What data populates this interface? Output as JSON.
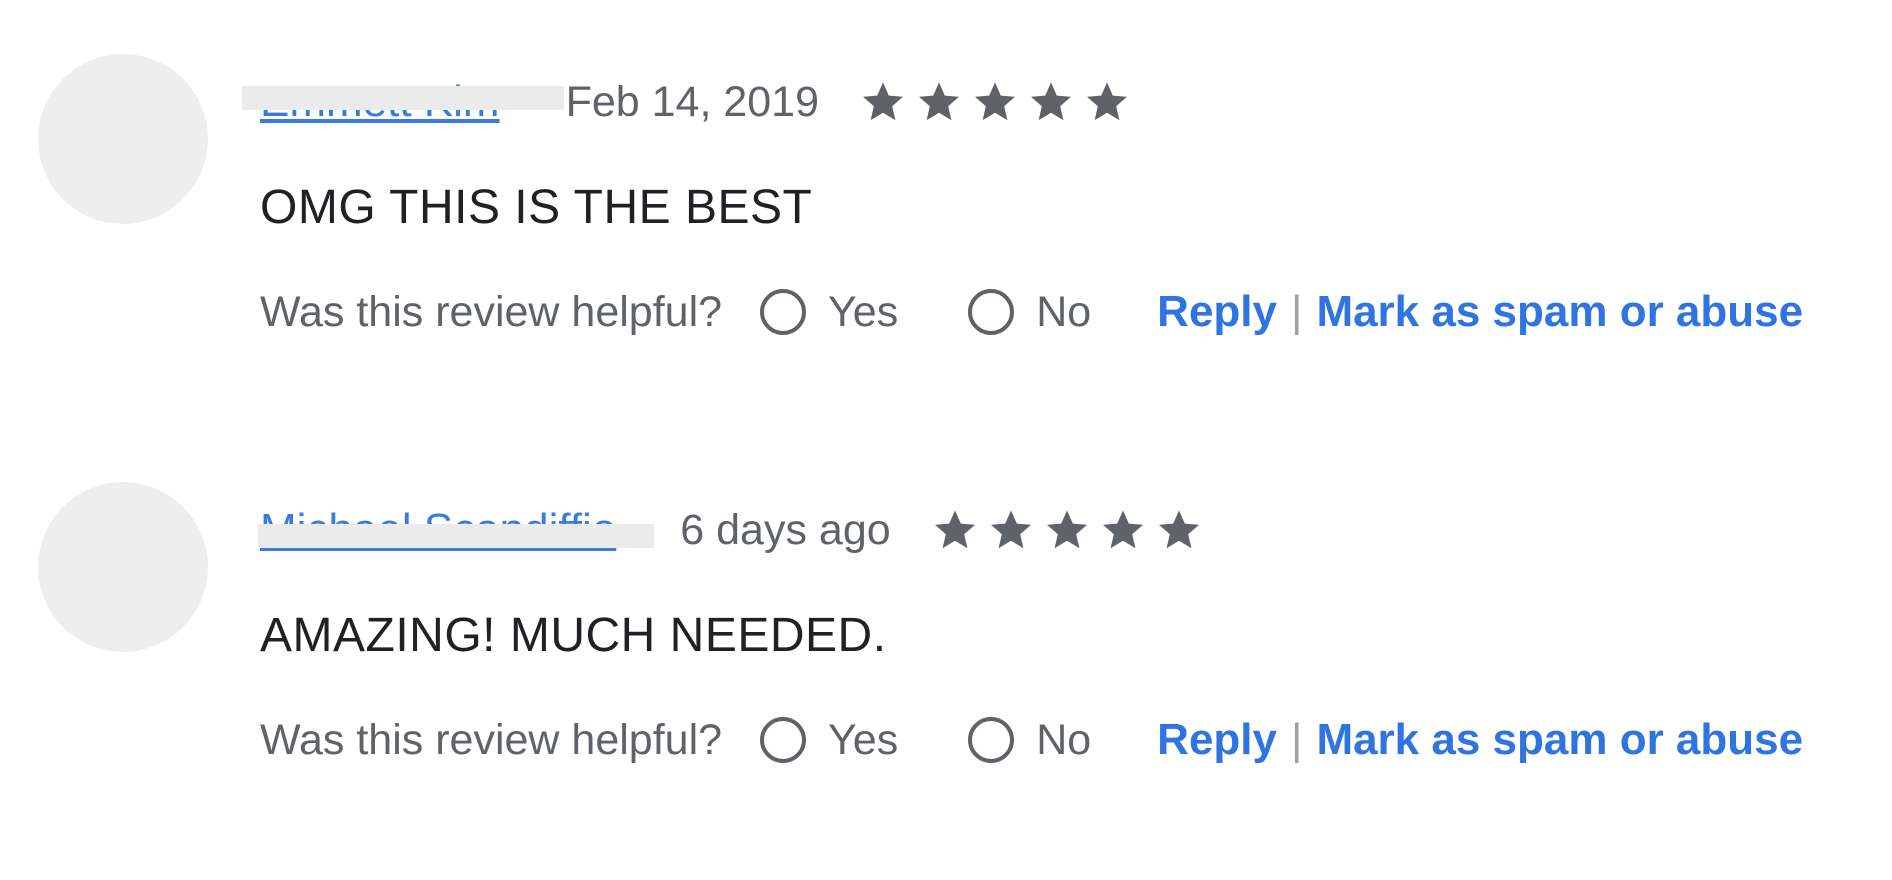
{
  "reviews": [
    {
      "author": "Emmett Kim",
      "date": "Feb 14, 2019",
      "rating": 5,
      "title": "OMG THIS IS THE BEST",
      "helpful_question": "Was this review helpful?",
      "yes_label": "Yes",
      "no_label": "No",
      "reply_label": "Reply",
      "separator": "|",
      "spam_label": "Mark as spam or abuse"
    },
    {
      "author": "Michael Scandiffio",
      "date": "6 days ago",
      "rating": 5,
      "title": "AMAZING! MUCH NEEDED.",
      "helpful_question": "Was this review helpful?",
      "yes_label": "Yes",
      "no_label": "No",
      "reply_label": "Reply",
      "separator": "|",
      "spam_label": "Mark as spam or abuse"
    }
  ],
  "icons": {
    "star": "star-icon",
    "radio": "radio-unchecked-icon"
  },
  "colors": {
    "link": "#2f74e0",
    "star": "#5f6368",
    "avatar": "#eeeeee",
    "muted_text": "#5f6368"
  }
}
